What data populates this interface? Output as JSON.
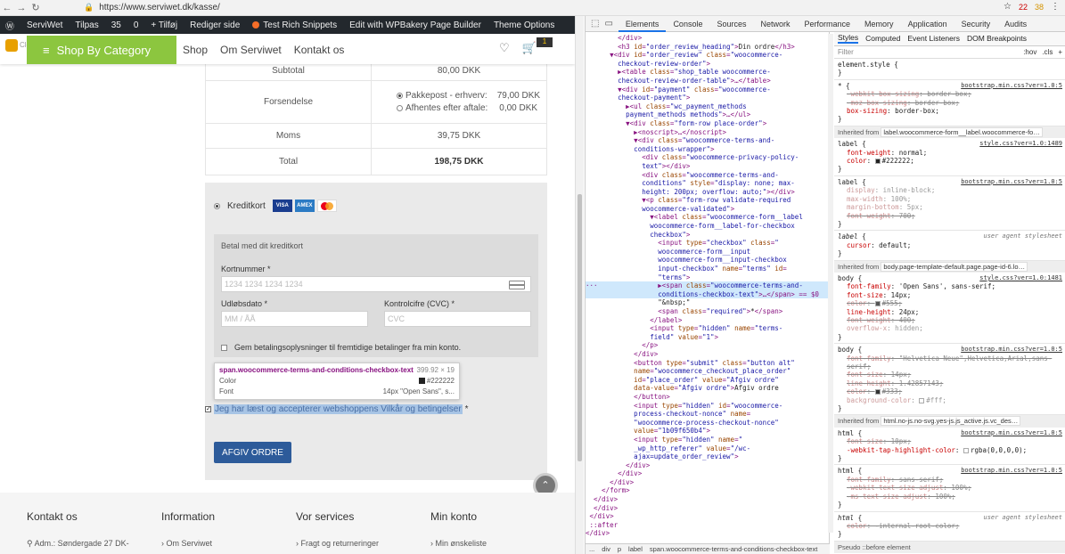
{
  "browser": {
    "url": "https://www.serviwet.dk/kasse/",
    "errors": "22",
    "warnings": "38"
  },
  "adminbar": {
    "items": [
      "ServiWet",
      "Tilpas",
      "35",
      "0",
      "+ Tilføj",
      "Rediger side",
      "Test Rich Snippets",
      "Edit with WPBakery Page Builder",
      "Theme Options"
    ]
  },
  "header": {
    "logo_text": "Clear Cache",
    "category_button": "Shop By Category",
    "menu": [
      "Shop",
      "Om Serviwet",
      "Kontakt os"
    ],
    "cart_count": "1"
  },
  "order": {
    "subtotal_label": "Subtotal",
    "subtotal_value": "80,00 DKK",
    "shipping_label": "Forsendelse",
    "shipping_options": [
      {
        "label": "Pakkepost - erhverv:",
        "price": "79,00 DKK",
        "selected": true
      },
      {
        "label": "Afhentes efter aftale:",
        "price": "0,00 DKK",
        "selected": false
      }
    ],
    "vat_label": "Moms",
    "vat_value": "39,75 DKK",
    "total_label": "Total",
    "total_value": "198,75 DKK"
  },
  "payment": {
    "method_label": "Kreditkort",
    "card_logos": [
      "VISA",
      "AMEX",
      "MC"
    ],
    "description": "Betal med dit kreditkort",
    "card_number_label": "Kortnummer *",
    "card_number_placeholder": "1234 1234 1234 1234",
    "expiry_label": "Udløbsdato *",
    "expiry_placeholder": "MM / ÅÅ",
    "cvc_label": "Kontrolcifre (CVC) *",
    "cvc_placeholder": "CVC",
    "save_label": "Gem betalingsoplysninger til fremtidige betalinger fra min konto."
  },
  "tooltip": {
    "selector": "span.woocommerce-terms-and-conditions-checkbox-text",
    "size": "399.92 × 19",
    "color_label": "Color",
    "color_value": "#222222",
    "font_label": "Font",
    "font_value": "14px \"Open Sans\", s..."
  },
  "terms": {
    "text": "Jeg har læst og accepterer webshoppens Vilkår og betingelser",
    "required": "*"
  },
  "place_order_label": "AFGIV ORDRE",
  "footer": {
    "columns": [
      {
        "title": "Kontakt os",
        "item": "Adm.: Søndergade 27 DK-"
      },
      {
        "title": "Information",
        "item": "Om Serviwet"
      },
      {
        "title": "Vor services",
        "item": "Fragt og returneringer"
      },
      {
        "title": "Min konto",
        "item": "Min ønskeliste"
      }
    ]
  },
  "devtools": {
    "tabs": [
      "Elements",
      "Console",
      "Sources",
      "Network",
      "Performance",
      "Memory",
      "Application",
      "Security",
      "Audits"
    ],
    "active_tab": "Elements",
    "style_tabs": [
      "Styles",
      "Computed",
      "Event Listeners",
      "DOM Breakpoints"
    ],
    "filter_placeholder": "Filter",
    "filter_opts": [
      ":hov",
      ".cls",
      "+"
    ],
    "breadcrumb": [
      "...",
      "div",
      "p",
      "label",
      "span.woocommerce-terms-and-conditions-checkbox-text"
    ]
  }
}
